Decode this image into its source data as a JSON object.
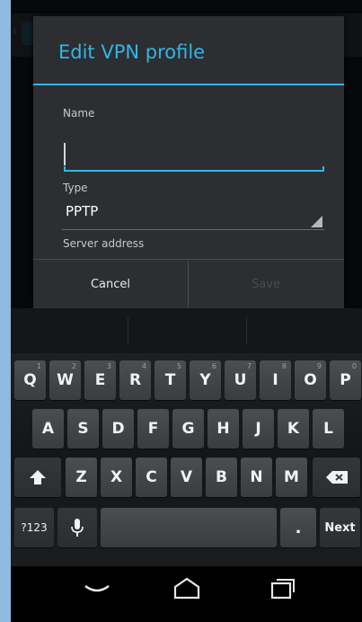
{
  "dialog": {
    "title": "Edit VPN profile",
    "name_label": "Name",
    "name_value": "",
    "type_label": "Type",
    "type_value": "PPTP",
    "server_label": "Server address",
    "cancel_label": "Cancel",
    "save_label": "Save"
  },
  "keyboard": {
    "row1": [
      {
        "k": "Q",
        "h": "1"
      },
      {
        "k": "W",
        "h": "2"
      },
      {
        "k": "E",
        "h": "3"
      },
      {
        "k": "R",
        "h": "4"
      },
      {
        "k": "T",
        "h": "5"
      },
      {
        "k": "Y",
        "h": "6"
      },
      {
        "k": "U",
        "h": "7"
      },
      {
        "k": "I",
        "h": "8"
      },
      {
        "k": "O",
        "h": "9"
      },
      {
        "k": "P",
        "h": "0"
      }
    ],
    "row2": [
      "A",
      "S",
      "D",
      "F",
      "G",
      "H",
      "J",
      "K",
      "L"
    ],
    "row3": [
      "Z",
      "X",
      "C",
      "V",
      "B",
      "N",
      "M"
    ],
    "symbols_label": "?123",
    "period_label": ".",
    "next_label": "Next"
  },
  "icons": {
    "shift": "shift-icon",
    "backspace": "backspace-icon",
    "mic": "microphone-icon",
    "back": "back-nav-icon",
    "home": "home-nav-icon",
    "recents": "recent-apps-icon"
  },
  "colors": {
    "accent": "#33b5e5",
    "dialog_bg": "#2c2e31",
    "key_bg": "#45484b"
  }
}
